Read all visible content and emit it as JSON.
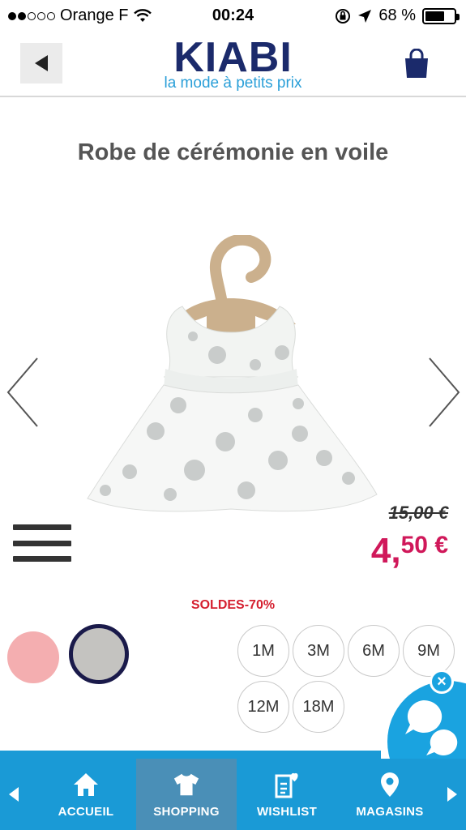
{
  "status_bar": {
    "carrier": "Orange F",
    "time": "00:24",
    "battery": "68 %",
    "battery_level": 0.68,
    "signal_bars_filled": 2,
    "signal_bars_total": 5
  },
  "header": {
    "logo_text": "KIABI",
    "tagline": "la mode à petits prix"
  },
  "product": {
    "title": "Robe de cérémonie en voile",
    "old_price": "15,00 €",
    "new_price_int": "4,",
    "new_price_dec": "50 €",
    "promo": "SOLDES-70%"
  },
  "colors_swatches": [
    {
      "name": "pink",
      "color": "#f4aeb0"
    },
    {
      "name": "grey",
      "color": "#c4c3c0",
      "selected": true
    }
  ],
  "sizes": [
    "1M",
    "3M",
    "6M",
    "9M",
    "12M",
    "18M"
  ],
  "chat": {
    "close_label": "×"
  },
  "nav": {
    "items": [
      {
        "label": "ACCUEIL",
        "icon": "home-icon"
      },
      {
        "label": "SHOPPING",
        "icon": "tshirt-icon",
        "active": true
      },
      {
        "label": "WISHLIST",
        "icon": "wishlist-icon"
      },
      {
        "label": "MAGASINS",
        "icon": "location-pin-icon"
      }
    ]
  },
  "theme": {
    "brand_navy": "#1b2a6b",
    "brand_blue": "#1a9ad6",
    "price_red": "#d0185a",
    "promo_red": "#d52030"
  }
}
